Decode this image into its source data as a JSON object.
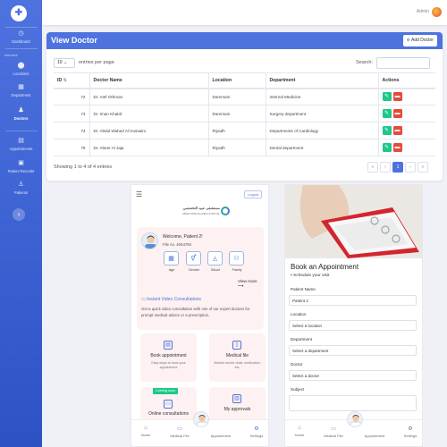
{
  "sidebar": {
    "items": [
      {
        "label": "Dashboard",
        "icon": "dashboard-icon"
      },
      {
        "label": "Locations",
        "icon": "map-marker-icon"
      },
      {
        "label": "Department",
        "icon": "department-icon"
      },
      {
        "label": "Doctors",
        "icon": "user-md-icon"
      },
      {
        "label": "Appointments",
        "icon": "calendar-icon"
      },
      {
        "label": "Patient Records",
        "icon": "records-icon"
      },
      {
        "label": "Patients",
        "icon": "user-icon"
      }
    ],
    "heading": "Interface"
  },
  "topbar": {
    "user_name": "Admin"
  },
  "page": {
    "title": "View Doctor",
    "add_button": "Add Doctor"
  },
  "table_controls": {
    "length_value": "10",
    "length_suffix": "entries per page",
    "search_label": "Search:"
  },
  "table": {
    "columns": [
      "ID",
      "Doctor Name",
      "Location",
      "Department",
      "Actions"
    ],
    "rows": [
      {
        "id": "72",
        "name": "Dr. Atef Othman",
        "location": "Dammam",
        "department": "Internal Medicine"
      },
      {
        "id": "73",
        "name": "Dr. Iman Khalaf",
        "location": "Dammam",
        "department": "Surgery department"
      },
      {
        "id": "74",
        "name": "Dr. Abdul Wahed Al Hussaini",
        "location": "Riyadh",
        "department": "Departments of Cardiology"
      },
      {
        "id": "75",
        "name": "Dr. Abeer Al Jaja",
        "location": "Riyadh",
        "department": "Dental department"
      }
    ]
  },
  "footer": {
    "showing": "Showing 1 to 4 of 4 entries",
    "pages": [
      "«",
      "‹",
      "1",
      "›",
      "»"
    ],
    "current_page": "1"
  },
  "phone1": {
    "logout": "Logout",
    "logo_ar": "مستشفى عبيد التخصصي",
    "logo_en": "OBEID SPECIALIZED HOSPITAL",
    "welcome": "Welcome, Patient 2!",
    "file_no": "File no. 4054784",
    "quick": [
      "Age",
      "Gender",
      "Blood",
      "Family"
    ],
    "view_more": "View more ⟶",
    "video_title": "Instant Video Consultations",
    "video_desc": "Get a quick video consultation with one of our expert doctors for prompt medical advice or a prescription.",
    "tiles": [
      {
        "title": "Book appointment",
        "desc": "Easy steps to book your appointment"
      },
      {
        "title": "Medical file",
        "desc": "Monitor doctor visits, medication, etc."
      },
      {
        "title": "Online consultations",
        "desc": ""
      },
      {
        "title": "My approvals",
        "desc": ""
      }
    ],
    "coming_soon": "Coming soon",
    "nav": [
      "Home",
      "Medical File",
      "Appointment",
      "Settings"
    ]
  },
  "phone2": {
    "title": "Book an Appointment",
    "subtitle": "Schedule your visit",
    "fields": [
      {
        "label": "Patient Name",
        "value": "Patient 2"
      },
      {
        "label": "Location",
        "value": "Select a location"
      },
      {
        "label": "Department",
        "value": "Select a department"
      },
      {
        "label": "Doctor",
        "value": "Select a doctor"
      },
      {
        "label": "Subject",
        "value": ""
      }
    ],
    "nav": [
      "Home",
      "Medical File",
      "Appointment",
      "Settings"
    ]
  },
  "colors": {
    "primary": "#4e73df",
    "success": "#1cc88a",
    "danger": "#e74a3b"
  }
}
